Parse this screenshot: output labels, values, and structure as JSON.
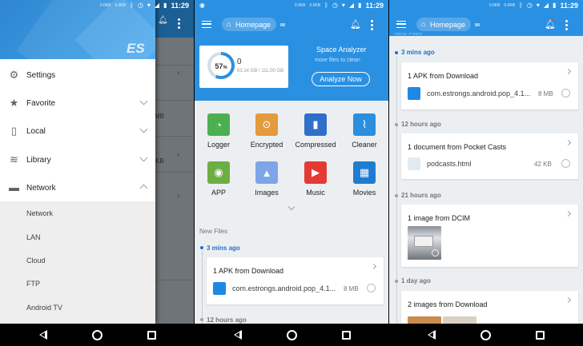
{
  "status": {
    "time": "11:29",
    "net1": "0.0KB",
    "net2": "0.0KB"
  },
  "screen1": {
    "logo": "ES",
    "menu": [
      {
        "label": "Settings",
        "icon": "gear-icon",
        "glyph": "⚙"
      },
      {
        "label": "Favorite",
        "icon": "star-icon",
        "glyph": "★"
      },
      {
        "label": "Local",
        "icon": "phone-icon",
        "glyph": "▯"
      },
      {
        "label": "Library",
        "icon": "layers-icon",
        "glyph": "≋"
      },
      {
        "label": "Network",
        "icon": "router-icon",
        "glyph": "▬"
      }
    ],
    "network_items": [
      "Network",
      "LAN",
      "Cloud",
      "FTP",
      "Android TV"
    ],
    "bg_fragments": [
      "MB",
      "KB"
    ]
  },
  "screen2": {
    "homepage": "Homepage",
    "analyzer": {
      "title": "Space Analyzer",
      "subtitle": "more files to clean",
      "button": "Analyze Now",
      "percent": "57",
      "percent_unit": "%",
      "used": "0",
      "capacity": "63.14 GB / 111.00 GB",
      "used_fraction": 0.57
    },
    "categories": [
      {
        "label": "Logger",
        "icon": "logger-icon",
        "glyph": "◔",
        "color": "#4caf50"
      },
      {
        "label": "Encrypted",
        "icon": "encrypted-icon",
        "glyph": "⊙",
        "color": "#e39b3b"
      },
      {
        "label": "Compressed",
        "icon": "compressed-icon",
        "glyph": "▮",
        "color": "#2f6fc9"
      },
      {
        "label": "Cleaner",
        "icon": "broom-icon",
        "glyph": "⌇",
        "color": "#2a8fdf"
      },
      {
        "label": "APP",
        "icon": "android-icon",
        "glyph": "◉",
        "color": "#6dae42"
      },
      {
        "label": "Images",
        "icon": "image-icon",
        "glyph": "▲",
        "color": "#7ea5e8"
      },
      {
        "label": "Music",
        "icon": "play-icon",
        "glyph": "▶",
        "color": "#e53935"
      },
      {
        "label": "Movies",
        "icon": "clapper-icon",
        "glyph": "▦",
        "color": "#1f7cd0"
      }
    ],
    "new_files": "New Files",
    "groups": [
      {
        "time": "3 mins ago",
        "title": "1 APK from Download",
        "file": "com.estrongs.android.pop_4.1...",
        "size": "8 MB"
      },
      {
        "time": "12 hours ago"
      }
    ]
  },
  "screen3": {
    "homepage": "Homepage",
    "header_fragment": "New Files",
    "groups": [
      {
        "time": "3 mins ago",
        "title": "1 APK from Download",
        "file": "com.estrongs.android.pop_4.1...",
        "size": "8 MB"
      },
      {
        "time": "12 hours ago",
        "title": "1 document from Pocket Casts",
        "file": "podcasts.html",
        "size": "42 KB"
      },
      {
        "time": "21 hours ago",
        "title": "1 image from DCIM"
      },
      {
        "time": "1 day ago",
        "title": "2 images from Download"
      }
    ]
  },
  "colors": {
    "primary": "#2a90e2",
    "accent_time": "#1e6fcf"
  }
}
